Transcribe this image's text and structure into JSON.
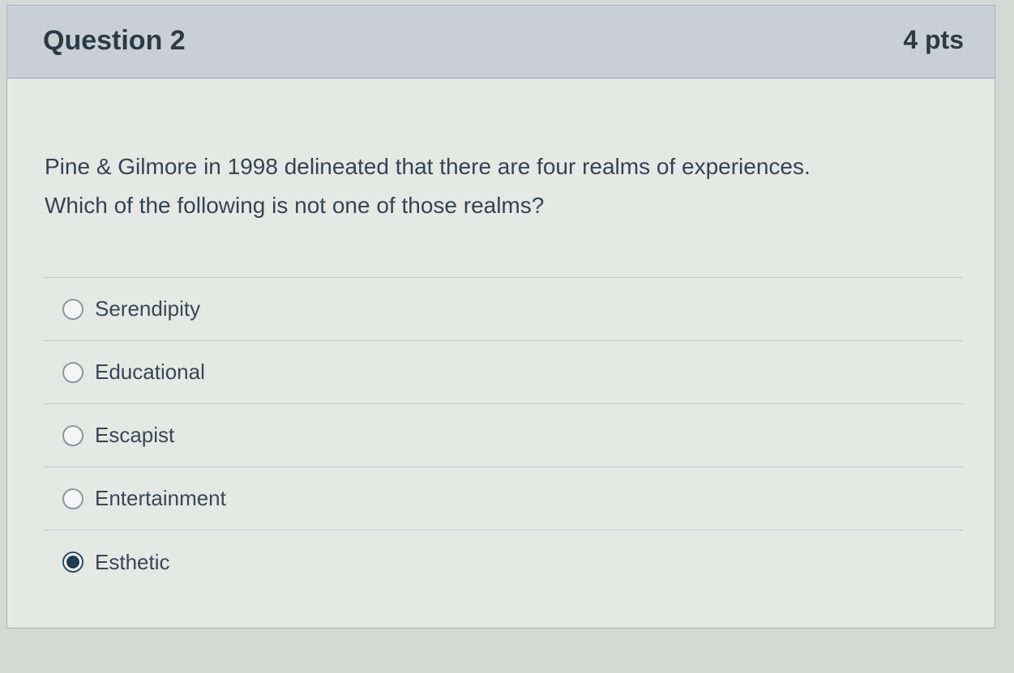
{
  "question": {
    "title": "Question 2",
    "points": "4 pts",
    "text_line1": "Pine & Gilmore in 1998 delineated that there are four realms of experiences.",
    "text_line2": "Which of the following is not one of those realms?"
  },
  "answers": [
    {
      "label": "Serendipity",
      "selected": false
    },
    {
      "label": "Educational",
      "selected": false
    },
    {
      "label": "Escapist",
      "selected": false
    },
    {
      "label": "Entertainment",
      "selected": false
    },
    {
      "label": "Esthetic",
      "selected": true
    }
  ],
  "colors": {
    "header_bg": "#c8d0d6",
    "card_bg": "#e4e9e6",
    "selected_radio": "#1f3b52"
  }
}
